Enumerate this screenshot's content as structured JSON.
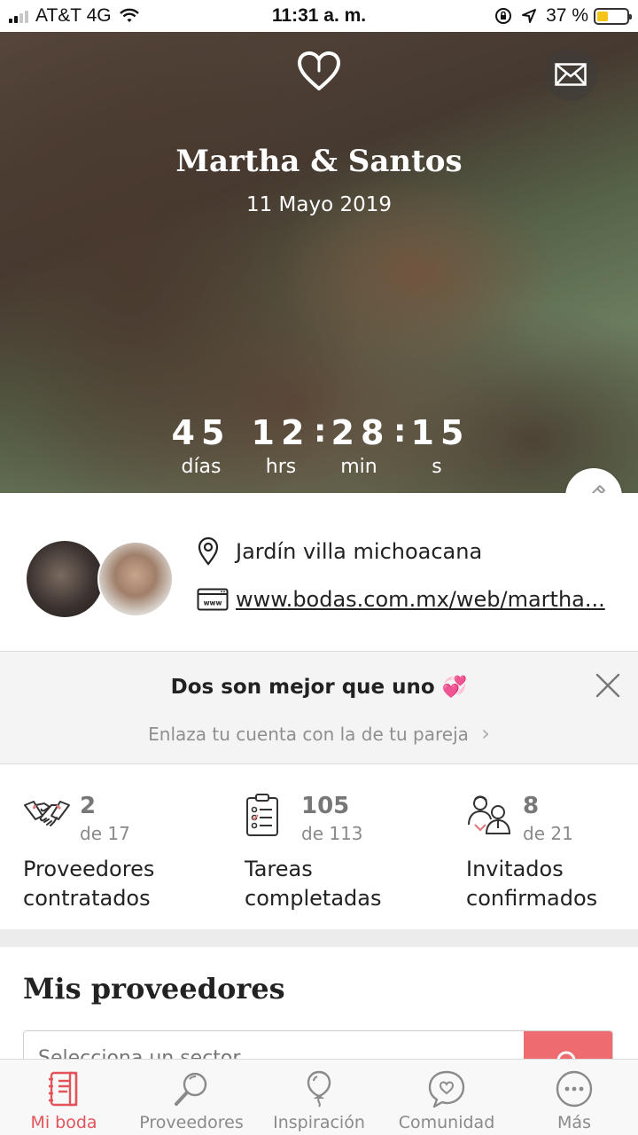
{
  "status_bar": {
    "carrier": "AT&T 4G",
    "time": "11:31 a. m.",
    "battery": "37 %",
    "battery_level": 0.37
  },
  "hero": {
    "couple": "Martha & Santos",
    "date": "11 Mayo 2019",
    "countdown": [
      {
        "value": "45",
        "label": "días"
      },
      {
        "value": "12",
        "label": "hrs"
      },
      {
        "value": "28",
        "label": "min"
      },
      {
        "value": "15",
        "label": "s"
      }
    ],
    "separator": ":"
  },
  "profile": {
    "venue": "Jardín villa michoacana",
    "website": "www.bodas.com.mx/web/martha..."
  },
  "promo": {
    "title": "Dos son mejor que uno 💞",
    "subtitle": "Enlaza tu cuenta con la de tu pareja",
    "chevron": "›"
  },
  "stats": [
    {
      "value": "2",
      "total": "de 17",
      "label": "Proveedores contratados",
      "icon": "handshake-icon"
    },
    {
      "value": "105",
      "total": "de 113",
      "label": "Tareas completadas",
      "icon": "clipboard-icon"
    },
    {
      "value": "8",
      "total": "de 21",
      "label": "Invitados confirmados",
      "icon": "guests-icon"
    }
  ],
  "providers": {
    "title": "Mis proveedores",
    "search_placeholder": "Selecciona un sector"
  },
  "tabs": [
    {
      "label": "Mi boda",
      "icon": "notebook-icon",
      "active": true
    },
    {
      "label": "Proveedores",
      "icon": "magnifier-icon",
      "active": false
    },
    {
      "label": "Inspiración",
      "icon": "balloon-icon",
      "active": false
    },
    {
      "label": "Comunidad",
      "icon": "chat-heart-icon",
      "active": false
    },
    {
      "label": "Más",
      "icon": "more-icon",
      "active": false
    }
  ],
  "colors": {
    "accent": "#e2545a",
    "search_button": "#ee6b6f",
    "battery": "#f5c518"
  }
}
